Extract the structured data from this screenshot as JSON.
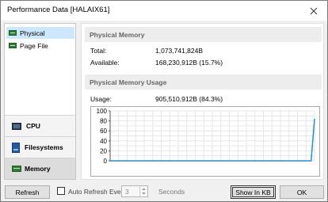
{
  "window": {
    "title": "Performance Data [HALAIX61]"
  },
  "sidebar": {
    "tree_items": [
      {
        "label": "Physical",
        "selected": true
      },
      {
        "label": "Page File",
        "selected": false
      }
    ],
    "categories": [
      {
        "label": "CPU",
        "icon": "cpu-icon",
        "active": false
      },
      {
        "label": "Filesystems",
        "icon": "filesystem-icon",
        "active": false
      },
      {
        "label": "Memory",
        "icon": "memory-icon",
        "active": true
      }
    ]
  },
  "main": {
    "physical_memory": {
      "header": "Physical Memory",
      "total_label": "Total:",
      "total_value": "1,073,741,824B",
      "available_label": "Available:",
      "available_value": "168,230,912B (15.7%)"
    },
    "usage_section": {
      "header": "Physical Memory Usage",
      "usage_label": "Usage:",
      "usage_value": "905,510,912B (84.3%)"
    }
  },
  "chart_data": {
    "type": "line",
    "ylim": [
      0,
      100
    ],
    "y_ticks": [
      "100",
      "80",
      "60",
      "40",
      "20",
      "0"
    ],
    "grid": true,
    "series": [
      {
        "values": [
          0,
          0,
          0,
          0,
          0,
          0,
          0,
          0,
          0,
          0,
          0,
          0,
          0,
          0,
          0,
          0,
          0,
          0,
          0,
          0,
          0,
          0,
          0,
          0,
          0,
          0,
          0,
          0,
          0,
          0,
          0,
          0,
          0,
          0,
          0,
          0,
          0,
          0,
          0,
          0,
          0,
          0,
          0,
          0,
          0,
          0,
          0,
          0,
          0,
          0,
          0,
          0,
          0,
          0,
          0,
          0,
          0,
          0,
          0,
          0,
          84
        ],
        "color": "#1e8fd8"
      }
    ]
  },
  "bottombar": {
    "refresh_label": "Refresh",
    "auto_refresh_label": "Auto Refresh Every",
    "interval_value": "3",
    "seconds_label": "Seconds",
    "show_in_kb_label": "Show In KB",
    "ok_label": "OK"
  }
}
